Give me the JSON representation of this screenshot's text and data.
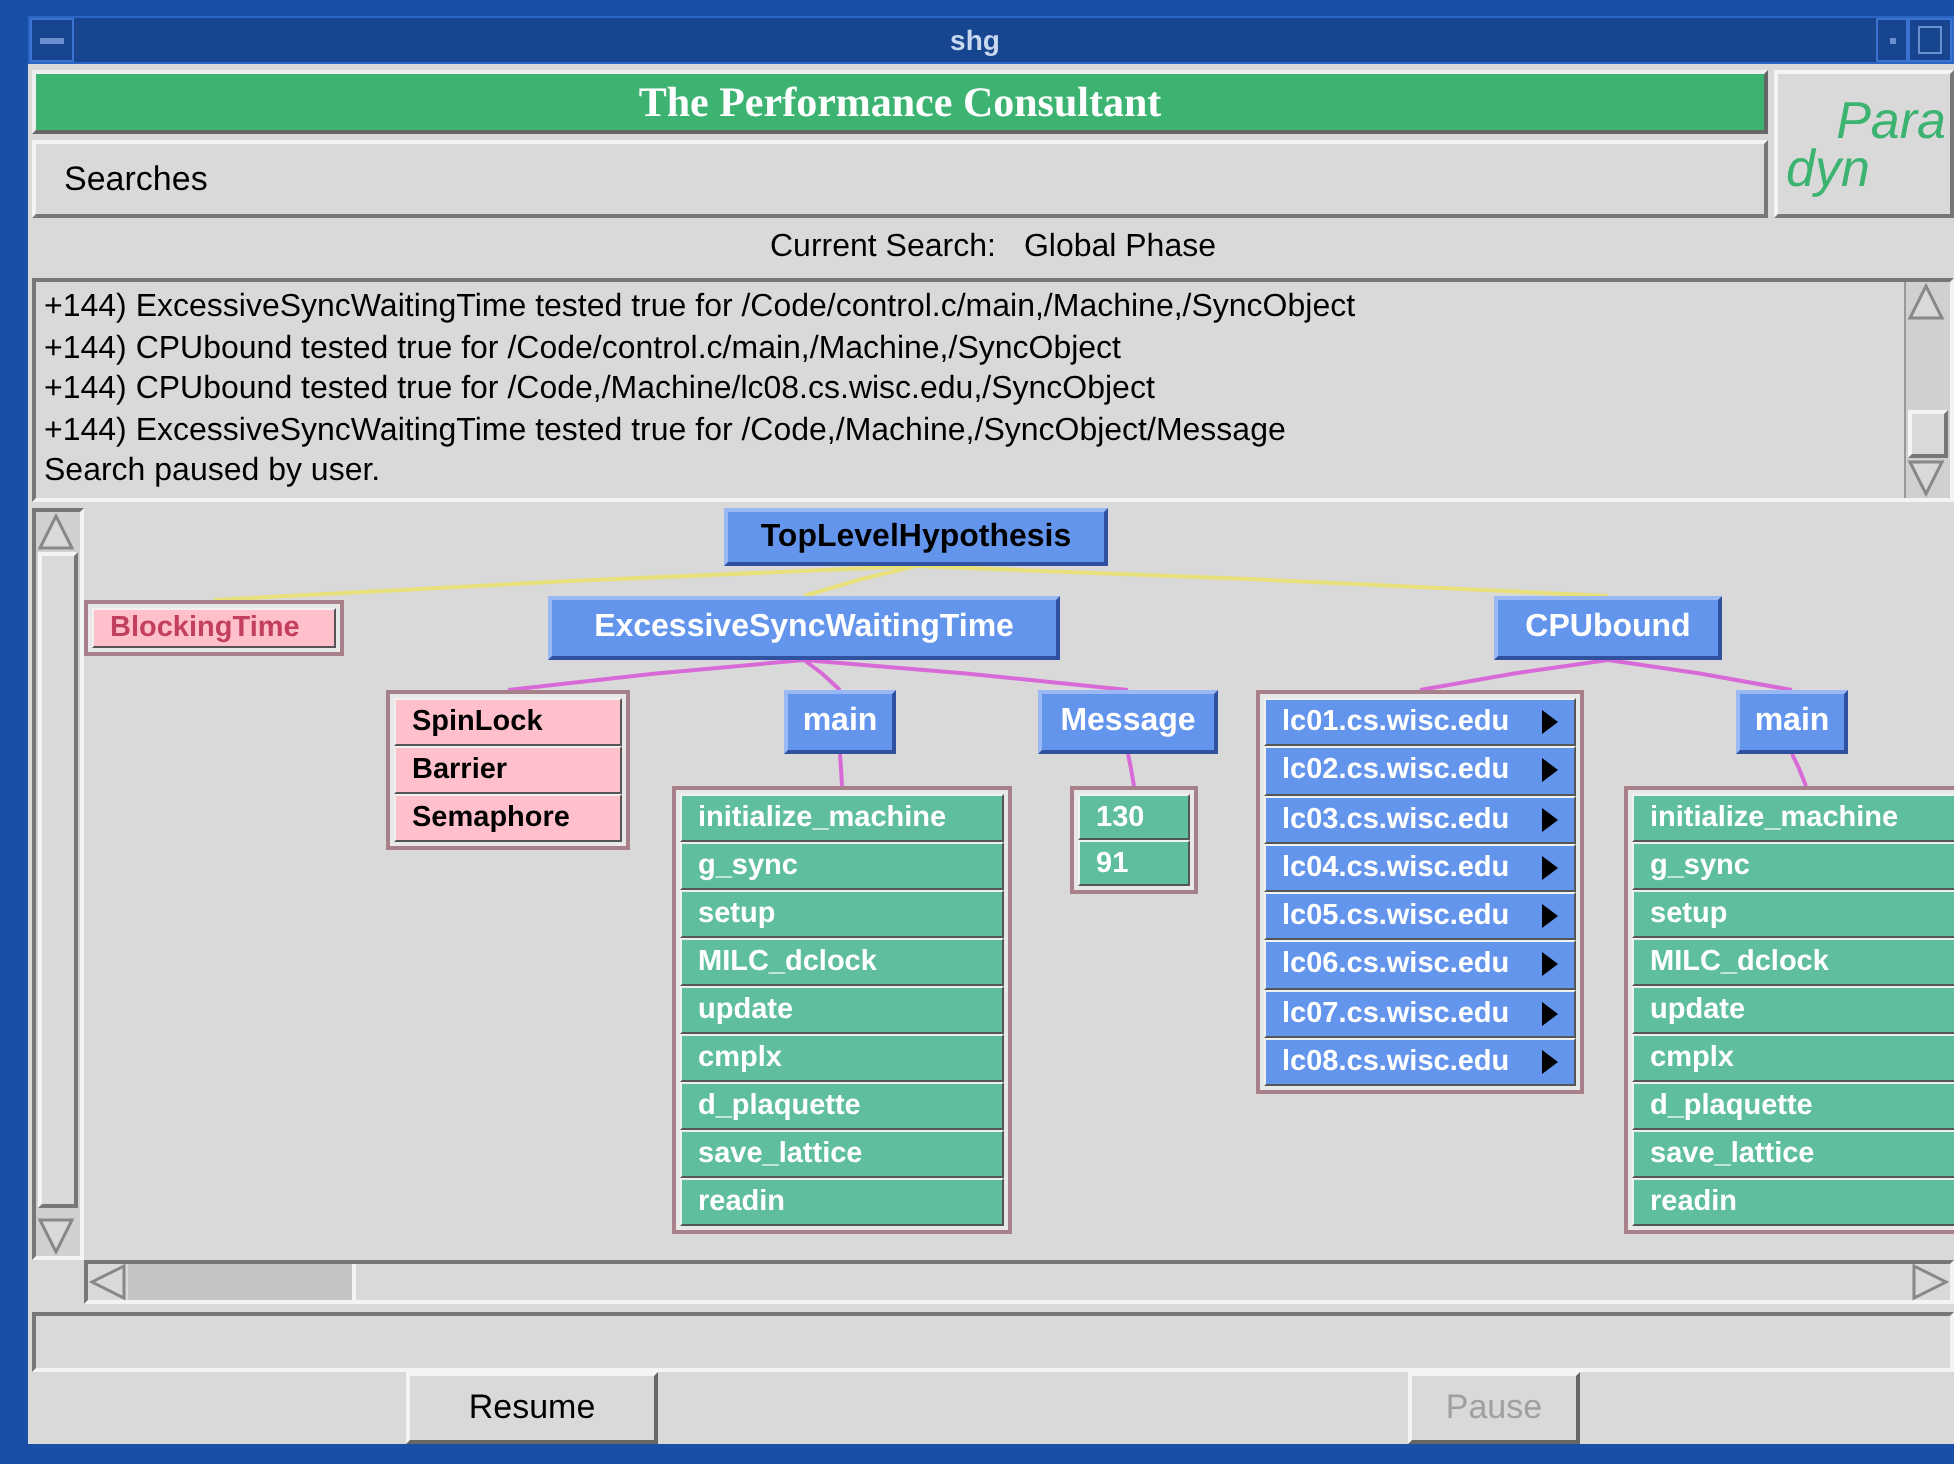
{
  "window": {
    "title": "shg"
  },
  "header": {
    "title": "The Performance Consultant"
  },
  "logo": {
    "lines": [
      "Para",
      "dyn"
    ]
  },
  "menu": {
    "label": "Searches"
  },
  "current_search": {
    "label": "Current Search:",
    "value": "Global Phase"
  },
  "log": {
    "lines": [
      "+144) ExcessiveSyncWaitingTime tested true for /Code/control.c/main,/Machine,/SyncObject",
      "+144) CPUbound tested true for /Code/control.c/main,/Machine,/SyncObject",
      "+144) CPUbound tested true for /Code,/Machine/lc08.cs.wisc.edu,/SyncObject",
      "+144) ExcessiveSyncWaitingTime tested true for /Code,/Machine,/SyncObject/Message",
      "Search paused by user."
    ]
  },
  "graph": {
    "root": {
      "label": "TopLevelHypothesis",
      "color": "#6495ed",
      "children": [
        {
          "label": "BlockingTime",
          "color": "#ffc0cb",
          "dimmed": true
        },
        {
          "label": "ExcessiveSyncWaitingTime",
          "color": "#6495ed",
          "children": [
            {
              "label": "SpinLock",
              "color": "#ffc0cb"
            },
            {
              "label": "Barrier",
              "color": "#ffc0cb"
            },
            {
              "label": "Semaphore",
              "color": "#ffc0cb"
            },
            {
              "label": "main",
              "color": "#6495ed",
              "children": [
                {
                  "label": "initialize_machine",
                  "color": "#5fbf9c"
                },
                {
                  "label": "g_sync",
                  "color": "#5fbf9c"
                },
                {
                  "label": "setup",
                  "color": "#5fbf9c"
                },
                {
                  "label": "MILC_dclock",
                  "color": "#5fbf9c"
                },
                {
                  "label": "update",
                  "color": "#5fbf9c"
                },
                {
                  "label": "cmplx",
                  "color": "#5fbf9c"
                },
                {
                  "label": "d_plaquette",
                  "color": "#5fbf9c"
                },
                {
                  "label": "save_lattice",
                  "color": "#5fbf9c"
                },
                {
                  "label": "readin",
                  "color": "#5fbf9c"
                }
              ]
            },
            {
              "label": "Message",
              "color": "#6495ed",
              "children": [
                {
                  "label": "130",
                  "color": "#5fbf9c"
                },
                {
                  "label": "91",
                  "color": "#5fbf9c"
                }
              ]
            }
          ]
        },
        {
          "label": "CPUbound",
          "color": "#6495ed",
          "children": [
            {
              "label": "lc01.cs.wisc.edu",
              "color": "#6495ed",
              "expandable": true
            },
            {
              "label": "lc02.cs.wisc.edu",
              "color": "#6495ed",
              "expandable": true
            },
            {
              "label": "lc03.cs.wisc.edu",
              "color": "#6495ed",
              "expandable": true
            },
            {
              "label": "lc04.cs.wisc.edu",
              "color": "#6495ed",
              "expandable": true
            },
            {
              "label": "lc05.cs.wisc.edu",
              "color": "#6495ed",
              "expandable": true
            },
            {
              "label": "lc06.cs.wisc.edu",
              "color": "#6495ed",
              "expandable": true
            },
            {
              "label": "lc07.cs.wisc.edu",
              "color": "#6495ed",
              "expandable": true
            },
            {
              "label": "lc08.cs.wisc.edu",
              "color": "#6495ed",
              "expandable": true
            },
            {
              "label": "main",
              "color": "#6495ed",
              "children": [
                {
                  "label": "initialize_machine",
                  "color": "#5fbf9c"
                },
                {
                  "label": "g_sync",
                  "color": "#5fbf9c"
                },
                {
                  "label": "setup",
                  "color": "#5fbf9c"
                },
                {
                  "label": "MILC_dclock",
                  "color": "#5fbf9c"
                },
                {
                  "label": "update",
                  "color": "#5fbf9c"
                },
                {
                  "label": "cmplx",
                  "color": "#5fbf9c"
                },
                {
                  "label": "d_plaquette",
                  "color": "#5fbf9c"
                },
                {
                  "label": "save_lattice",
                  "color": "#5fbf9c"
                },
                {
                  "label": "readin",
                  "color": "#5fbf9c"
                }
              ]
            }
          ]
        }
      ]
    }
  },
  "buttons": [
    {
      "label": "Resume",
      "disabled": false
    },
    {
      "label": "Pause",
      "disabled": true
    }
  ]
}
